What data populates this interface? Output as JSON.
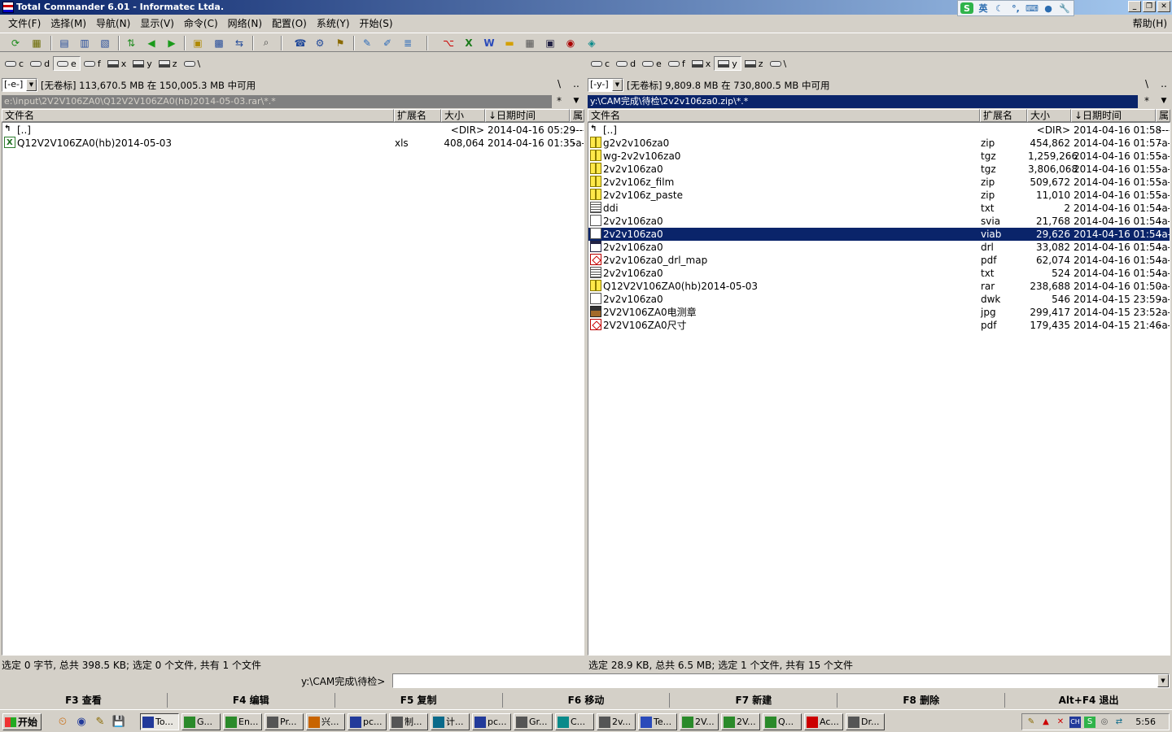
{
  "window": {
    "title": "Total Commander 6.01 - Informatec Ltda.",
    "controls": [
      "_",
      "❐",
      "✕"
    ]
  },
  "ime": {
    "items": [
      "S",
      "英",
      "☾",
      "°,",
      "⌨",
      "●",
      "🔧"
    ]
  },
  "menu": {
    "items": [
      "文件(F)",
      "选择(M)",
      "导航(N)",
      "显示(V)",
      "命令(C)",
      "网络(N)",
      "配置(O)",
      "系统(Y)",
      "开始(S)"
    ],
    "help": "帮助(H)"
  },
  "toolbar": {
    "icons": [
      "refresh-icon",
      "thumbnail-icon",
      "brief-view-icon",
      "full-view-icon",
      "tree-view-icon",
      "swap-icon",
      "back-icon",
      "forward-icon",
      "pack-icon",
      "unpack-icon",
      "sync-icon",
      "find-icon",
      "ftp-icon",
      "ftp-new-icon",
      "net-icon",
      "notepad-icon",
      "copy-names-icon",
      "multi-rename-icon",
      "pdf-icon",
      "excel-icon",
      "word-icon",
      "folder-icon",
      "app1-icon",
      "app2-icon",
      "app3-icon",
      "app4-icon"
    ]
  },
  "left": {
    "drives": [
      "c",
      "d",
      "e",
      "f",
      "x",
      "y",
      "z",
      "\\"
    ],
    "active_drive": "e",
    "combo": "[-e-]",
    "free_info": "[无卷标]  113,670.5 MB 在 150,005.3 MB 中可用",
    "root_btn": "\\",
    "up_btn": "..",
    "star": "*",
    "hist": "▼",
    "path": "e:\\input\\2V2V106ZA0\\Q12V2V106ZA0(hb)2014-05-03.rar\\*.*",
    "headers": {
      "name": "文件名",
      "ext": "扩展名",
      "size": "大小",
      "date": "↓日期时间",
      "attr": "属"
    },
    "files": [
      {
        "name": "[..]",
        "ext": "",
        "size": "<DIR>",
        "date": "2014-04-16 05:29",
        "attr": "----",
        "icon": "up"
      },
      {
        "name": "Q12V2V106ZA0(hb)2014-05-03",
        "ext": "xls",
        "size": "408,064",
        "date": "2014-04-16 01:35",
        "attr": "-a-",
        "icon": "xls"
      }
    ],
    "status": "选定 0 字节, 总共 398.5 KB; 选定 0 个文件, 共有 1 个文件"
  },
  "right": {
    "drives": [
      "c",
      "d",
      "e",
      "f",
      "x",
      "y",
      "z",
      "\\"
    ],
    "active_drive": "y",
    "combo": "[-y-]",
    "free_info": "[无卷标]  9,809.8 MB 在 730,800.5 MB 中可用",
    "root_btn": "\\",
    "up_btn": "..",
    "star": "*",
    "hist": "▼",
    "path": "y:\\CAM完成\\待检\\2v2v106za0.zip\\*.*",
    "headers": {
      "name": "文件名",
      "ext": "扩展名",
      "size": "大小",
      "date": "↓日期时间",
      "attr": "属"
    },
    "files": [
      {
        "name": "[..]",
        "ext": "",
        "size": "<DIR>",
        "date": "2014-04-16 01:58",
        "attr": "----",
        "icon": "up"
      },
      {
        "name": "g2v2v106za0",
        "ext": "zip",
        "size": "454,862",
        "date": "2014-04-16 01:57",
        "attr": "-a-",
        "icon": "arc"
      },
      {
        "name": "wg-2v2v106za0",
        "ext": "tgz",
        "size": "1,259,266",
        "date": "2014-04-16 01:55",
        "attr": "-a-",
        "icon": "arc"
      },
      {
        "name": "2v2v106za0",
        "ext": "tgz",
        "size": "3,806,068",
        "date": "2014-04-16 01:55",
        "attr": "-a-",
        "icon": "arc"
      },
      {
        "name": "2v2v106z_film",
        "ext": "zip",
        "size": "509,672",
        "date": "2014-04-16 01:55",
        "attr": "-a-",
        "icon": "arc"
      },
      {
        "name": "2v2v106z_paste",
        "ext": "zip",
        "size": "11,010",
        "date": "2014-04-16 01:55",
        "attr": "-a-",
        "icon": "arc"
      },
      {
        "name": "ddi",
        "ext": "txt",
        "size": "2",
        "date": "2014-04-16 01:54",
        "attr": "-a-",
        "icon": "txt"
      },
      {
        "name": "2v2v106za0",
        "ext": "svia",
        "size": "21,768",
        "date": "2014-04-16 01:54",
        "attr": "-a-",
        "icon": "doc"
      },
      {
        "name": "2v2v106za0",
        "ext": "viab",
        "size": "29,626",
        "date": "2014-04-16 01:54",
        "attr": "-a-",
        "icon": "doc",
        "selected": true
      },
      {
        "name": "2v2v106za0",
        "ext": "drl",
        "size": "33,082",
        "date": "2014-04-16 01:54",
        "attr": "-a-",
        "icon": "drl"
      },
      {
        "name": "2v2v106za0_drl_map",
        "ext": "pdf",
        "size": "62,074",
        "date": "2014-04-16 01:54",
        "attr": "-a-",
        "icon": "pdf"
      },
      {
        "name": "2v2v106za0",
        "ext": "txt",
        "size": "524",
        "date": "2014-04-16 01:54",
        "attr": "-a-",
        "icon": "txt"
      },
      {
        "name": "Q12V2V106ZA0(hb)2014-05-03",
        "ext": "rar",
        "size": "238,688",
        "date": "2014-04-16 01:50",
        "attr": "-a-",
        "icon": "arc"
      },
      {
        "name": "2v2v106za0",
        "ext": "dwk",
        "size": "546",
        "date": "2014-04-15 23:59",
        "attr": "-a-",
        "icon": "doc"
      },
      {
        "name": "2V2V106ZA0电测章",
        "ext": "jpg",
        "size": "299,417",
        "date": "2014-04-15 23:52",
        "attr": "-a-",
        "icon": "img"
      },
      {
        "name": "2V2V106ZA0尺寸",
        "ext": "pdf",
        "size": "179,435",
        "date": "2014-04-15 21:46",
        "attr": "-a-",
        "icon": "pdf"
      }
    ],
    "status": "选定 28.9 KB, 总共 6.5 MB; 选定 1 个文件, 共有 15 个文件"
  },
  "cmd": {
    "label": "y:\\CAM完成\\待检>",
    "value": "",
    "arrow": "▼"
  },
  "fkeys": [
    "F3 查看",
    "F4 编辑",
    "F5 复制",
    "F6 移动",
    "F7 新建",
    "F8 删除",
    "Alt+F4 退出"
  ],
  "taskbar": {
    "start": "开始",
    "quicklaunch": [
      "⏲",
      "◉",
      "✎",
      "💾"
    ],
    "tasks": [
      "To...",
      "G...",
      "En...",
      "Pr...",
      "兴...",
      "pc...",
      "制...",
      "计...",
      "pc...",
      "Gr...",
      "C...",
      "2v...",
      "Te...",
      "2V...",
      "2V...",
      "Q...",
      "Ac...",
      "Dr..."
    ],
    "active_task": 0,
    "tray_icons": [
      "✎",
      "▲",
      "✕",
      "CH",
      "S",
      "◎",
      "⇄"
    ],
    "clock": "5:56"
  }
}
